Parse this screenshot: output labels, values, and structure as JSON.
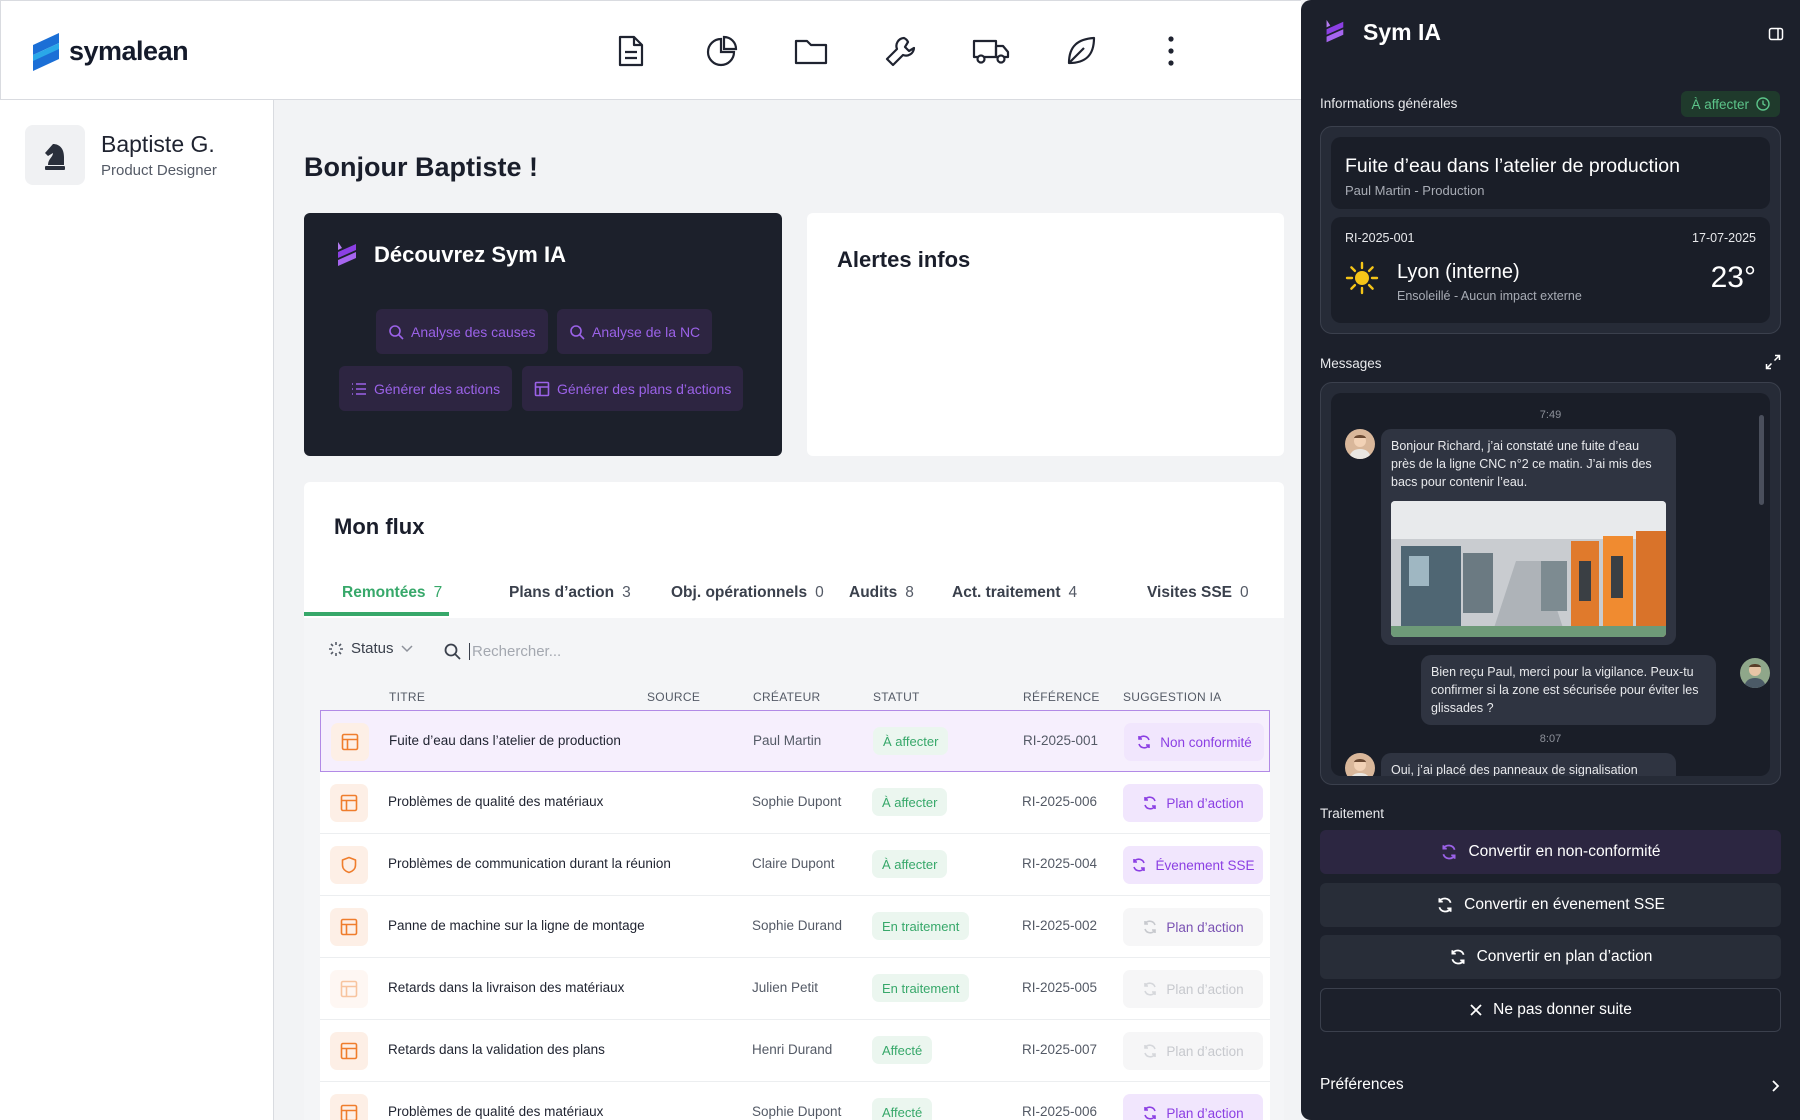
{
  "app": {
    "brand": "symalean"
  },
  "nav": {
    "icons": [
      "document-icon",
      "chart-icon",
      "folder-icon",
      "wrench-icon",
      "truck-icon",
      "leaf-icon",
      "more-icon"
    ]
  },
  "user": {
    "name": "Baptiste G.",
    "role": "Product Designer"
  },
  "main": {
    "greeting": "Bonjour Baptiste !",
    "ia_card": {
      "title": "Découvrez Sym IA",
      "chips": [
        "Analyse des causes",
        "Analyse de la NC",
        "Générer des actions",
        "Générer des plans d’actions"
      ]
    },
    "alerts": {
      "title": "Alertes infos"
    },
    "flux": {
      "title": "Mon flux",
      "tabs": [
        {
          "label": "Remontées",
          "count": "7"
        },
        {
          "label": "Plans d’action",
          "count": "3"
        },
        {
          "label": "Obj. opérationnels",
          "count": "0"
        },
        {
          "label": "Audits",
          "count": "8"
        },
        {
          "label": "Act. traitement",
          "count": "4"
        },
        {
          "label": "Visites SSE",
          "count": "0"
        }
      ],
      "status_filter": "Status",
      "search_placeholder": "Rechercher...",
      "columns": [
        "TITRE",
        "SOURCE",
        "CRÉATEUR",
        "STATUT",
        "RÉFÉRENCE",
        "SUGGESTION IA"
      ],
      "rows": [
        {
          "title": "Fuite d’eau dans l’atelier de production",
          "creator": "Paul Martin",
          "status": "À affecter",
          "ref": "RI-2025-001",
          "suggestion": "Non conformité",
          "icon": "grid-icon"
        },
        {
          "title": "Problèmes de qualité des matériaux",
          "creator": "Sophie Dupont",
          "status": "À affecter",
          "ref": "RI-2025-006",
          "suggestion": "Plan d’action",
          "icon": "grid-icon"
        },
        {
          "title": "Problèmes de communication durant la réunion",
          "creator": "Claire Dupont",
          "status": "À affecter",
          "ref": "RI-2025-004",
          "suggestion": "Évenement SSE",
          "icon": "shield-icon"
        },
        {
          "title": "Panne de machine sur la ligne de montage",
          "creator": "Sophie Durand",
          "status": "En traitement",
          "ref": "RI-2025-002",
          "suggestion": "Plan d’action",
          "icon": "grid-icon"
        },
        {
          "title": "Retards dans la livraison des matériaux",
          "creator": "Julien Petit",
          "status": "En traitement",
          "ref": "RI-2025-005",
          "suggestion": "Plan d’action",
          "icon": "grid-icon"
        },
        {
          "title": "Retards dans la validation des plans",
          "creator": "Henri Durand",
          "status": "Affecté",
          "ref": "RI-2025-007",
          "suggestion": "Plan d’action",
          "icon": "grid-icon"
        },
        {
          "title": "Problèmes de qualité des matériaux",
          "creator": "Sophie Dupont",
          "status": "Affecté",
          "ref": "RI-2025-006",
          "suggestion": "Plan d’action",
          "icon": "grid-icon"
        }
      ]
    }
  },
  "panel": {
    "title": "Sym IA",
    "general_label": "Informations générales",
    "state": "À affecter",
    "incident_title": "Fuite d’eau dans l’atelier de production",
    "incident_sub": "Paul Martin - Production",
    "ref": "RI-2025-001",
    "date": "17-07-2025",
    "city": "Lyon (interne)",
    "weather": "Ensoleillé - Aucun impact externe",
    "temp": "23°",
    "messages_label": "Messages",
    "messages": {
      "t1": "7:49",
      "m1": "Bonjour Richard, j’ai constaté une fuite d’eau près de la ligne CNC n°2 ce matin. J’ai mis des bacs pour contenir l’eau.",
      "m2": "Bien reçu Paul, merci pour la vigilance. Peux-tu confirmer si la zone est sécurisée pour éviter les glissades ?",
      "t2": "8:07",
      "m3": "Oui, j’ai placé des panneaux de signalisation"
    },
    "treatment_label": "Traitement",
    "actions": [
      "Convertir en non-conformité",
      "Convertir en évenement SSE",
      "Convertir en plan d’action",
      "Ne pas donner suite"
    ],
    "preferences": "Préférences"
  },
  "colors": {
    "accent_green": "#37a86a",
    "accent_purple": "#8b3fe3",
    "panel_bg": "#1c202b"
  }
}
